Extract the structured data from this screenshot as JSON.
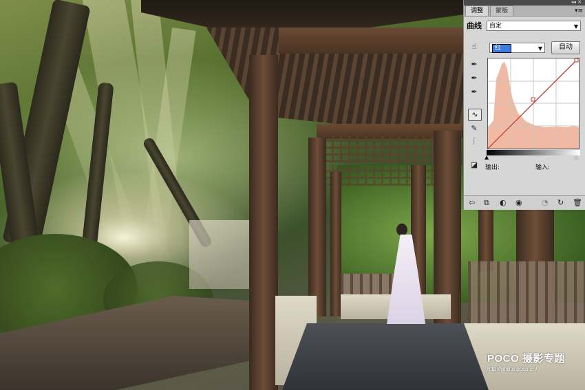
{
  "panel": {
    "tabs": [
      {
        "label": "调整",
        "active": true
      },
      {
        "label": "蒙版",
        "active": false
      }
    ],
    "title_controls": "◂◂ ✕",
    "menu_icon": "menu-icon",
    "curve_label": "曲线",
    "preset_value": "自定",
    "channel_value": "红",
    "auto_label": "自动",
    "output_label": "输出:",
    "input_label": "输入:",
    "curve_color": "#c0392b",
    "histogram_color": "#f0b9a3"
  },
  "watermark": {
    "logo": "POCO 摄影专题",
    "url": "http://photo.poco.cn/"
  }
}
